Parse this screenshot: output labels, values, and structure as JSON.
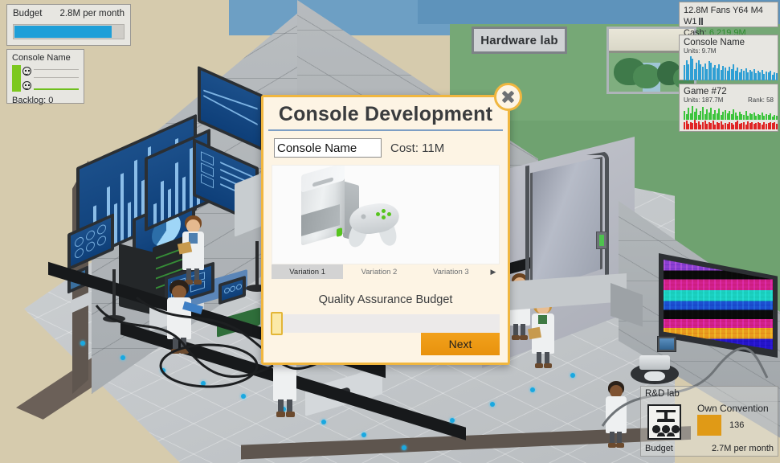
{
  "scene": {
    "room_sign": "Hardware lab"
  },
  "hud": {
    "budget_panel": {
      "label": "Budget",
      "value": "2.8M per month",
      "fill_percent": 88,
      "fill_color": "#1e9fd8"
    },
    "console_panel": {
      "title": "Console Name",
      "backlog": "Backlog: 0",
      "bar_color": "#7dc81e"
    },
    "stats_panel": {
      "line1": "12.8M Fans Y64 M4 W1",
      "cash_label": "Cash:",
      "cash_value": "6,219.9M",
      "cash_color": "#2e8b2e",
      "speed_icon": "pause-icon"
    },
    "graphs": [
      {
        "title": "Console Name",
        "units": "Units: 9.7M",
        "rank": "",
        "bar_color": "#2f9fd4"
      },
      {
        "title": "Game #72",
        "units": "Units: 187.7M",
        "rank": "Rank: 58",
        "bar_color_positive": "#3cc43c",
        "bar_color_negative": "#e02424"
      }
    ],
    "lab_panel": {
      "title": "R&D lab",
      "icon": "convention-icon",
      "convention_label": "Own Convention",
      "convention_count": "136",
      "swatch_color": "#e09a16",
      "budget_label": "Budget",
      "budget_value": "2.7M per month"
    }
  },
  "modal": {
    "title": "Console Development",
    "close_label": "×",
    "name_value": "Console Name",
    "name_placeholder": "Console Name",
    "cost_label": "Cost: 11M",
    "preview_icon": "console-preview",
    "variations": [
      {
        "label": "Variation 1",
        "active": true
      },
      {
        "label": "Variation 2",
        "active": false
      },
      {
        "label": "Variation 3",
        "active": false
      }
    ],
    "variations_next_arrow": "▶",
    "qa_label": "Quality Assurance Budget",
    "qa_slider_percent": 0,
    "next_label": "Next",
    "accent_color": "#f0b63f",
    "button_color": "#f2a11c"
  },
  "chart_data": [
    {
      "type": "bar",
      "title": "Console Name",
      "ylabel": "Units",
      "annotations": [
        "Units: 9.7M"
      ],
      "values": [
        55,
        72,
        60,
        88,
        78,
        42,
        66,
        74,
        58,
        50,
        62,
        40,
        70,
        64,
        48,
        56,
        44,
        60,
        38,
        52,
        46,
        36,
        50,
        42,
        58,
        34,
        46,
        30,
        40,
        36,
        44,
        28,
        38,
        32,
        42,
        26,
        34,
        30,
        38,
        24,
        32,
        28,
        34,
        22,
        30,
        26
      ],
      "ylim": [
        0,
        100
      ]
    },
    {
      "type": "bar",
      "title": "Game #72",
      "ylabel": "Units",
      "annotations": [
        "Units: 187.7M",
        "Rank: 58"
      ],
      "series": [
        {
          "name": "positive",
          "values": [
            46,
            30,
            62,
            34,
            70,
            40,
            56,
            26,
            44,
            66,
            30,
            52,
            38,
            60,
            28,
            48,
            34,
            58,
            24,
            42,
            50,
            32,
            46,
            28,
            54,
            36,
            22,
            40,
            30,
            26,
            44,
            20,
            34,
            28,
            38,
            22,
            30,
            26,
            36,
            20,
            28,
            24,
            32,
            18,
            26,
            22
          ]
        },
        {
          "name": "negative",
          "values": [
            28,
            34,
            22,
            30,
            26,
            38,
            24,
            32,
            20,
            28,
            36,
            22,
            30,
            26,
            34,
            20,
            28,
            24,
            32,
            18,
            26,
            22,
            30,
            24,
            20,
            28,
            34,
            22,
            26,
            30,
            20,
            32,
            24,
            28,
            22,
            26,
            30,
            24,
            20,
            28,
            22,
            26,
            30,
            24,
            28,
            22
          ]
        }
      ],
      "ylim": [
        -50,
        80
      ]
    }
  ]
}
